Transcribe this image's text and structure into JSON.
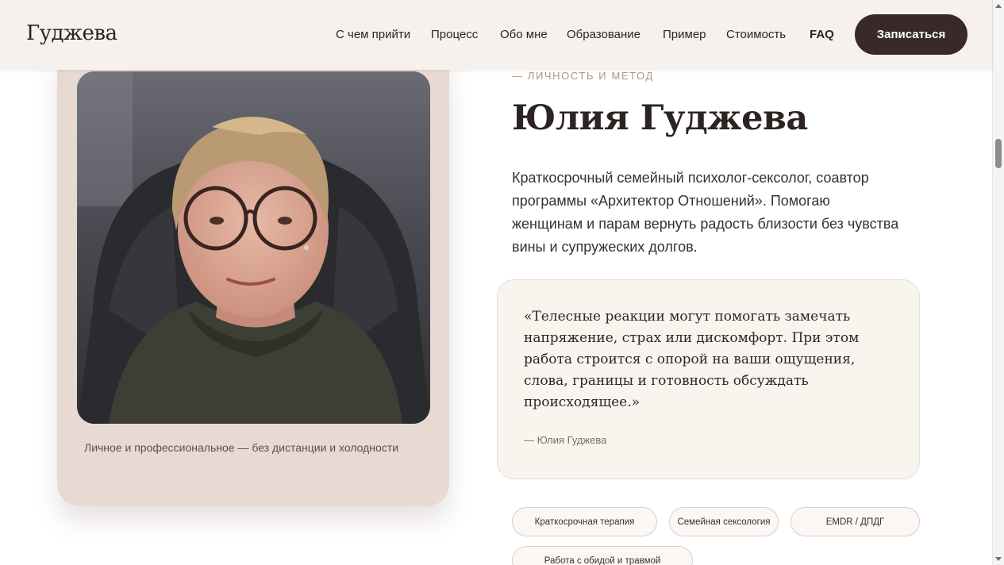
{
  "header": {
    "logo": "Гуджева",
    "nav": [
      {
        "label": "С чем прийти"
      },
      {
        "label": "Процесс"
      },
      {
        "label": "Обо мне"
      },
      {
        "label": "Образование"
      },
      {
        "label": "Пример"
      },
      {
        "label": "Стоимость"
      },
      {
        "label": "FAQ"
      }
    ],
    "cta_label": "Записаться"
  },
  "profile": {
    "caption": "Личное и профессиональное — без дистанции и холодности",
    "eyebrow": "— ЛИЧНОСТЬ И МЕТОД",
    "name": "Юлия Гуджева",
    "description": "Краткосрочный семейный психолог-сексолог, соавтор программы «Архитектор Отношений». Помогаю женщинам и парам вернуть радость близости без чувства вины и супружеских долгов."
  },
  "quote": {
    "text": "«Телесные реакции могут помогать замечать напряжение, страх или дискомфорт. При этом работа строится с опорой на ваши ощущения, слова, границы и готовность обсуждать происходящее.»",
    "author": "— Юлия Гуджева"
  },
  "tags": [
    {
      "label": "Краткосрочная терапия"
    },
    {
      "label": "Семейная сексология"
    },
    {
      "label": "EMDR / ДПДГ"
    },
    {
      "label": "Работа с обидой и травмой"
    }
  ],
  "colors": {
    "header_bg": "#f6f1ed",
    "cta_bg": "#372a28",
    "photo_card_bg": "#e8d9d2",
    "quote_card_bg": "#f8f4ee"
  }
}
